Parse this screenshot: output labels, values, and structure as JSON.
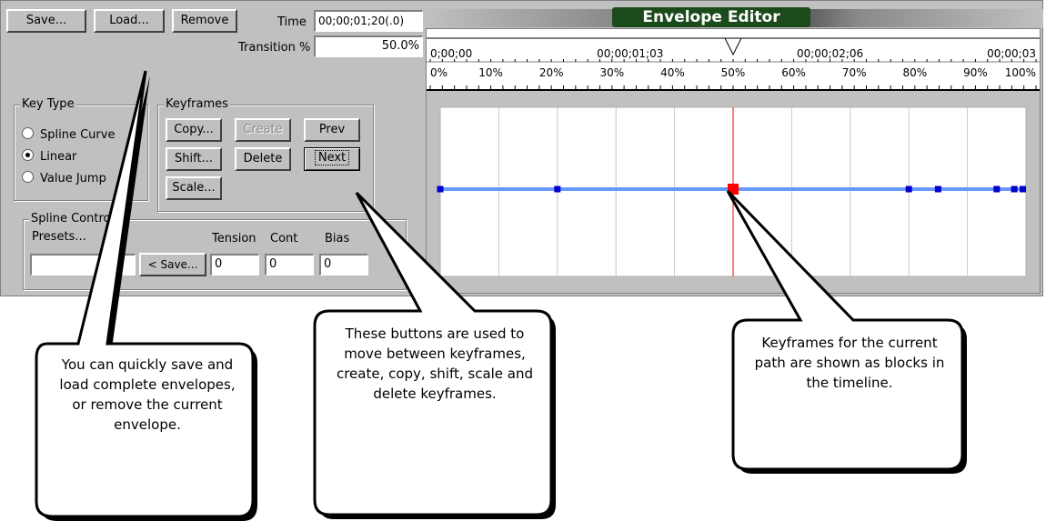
{
  "title": "Envelope Editor",
  "toolbar": {
    "save_label": "Save...",
    "load_label": "Load...",
    "remove_label": "Remove"
  },
  "time": {
    "label": "Time",
    "value": "00;00;01;20(.0)"
  },
  "transition": {
    "label": "Transition %",
    "value": "50.0%"
  },
  "key_type": {
    "legend": "Key Type",
    "options": [
      {
        "label": "Spline Curve",
        "selected": false
      },
      {
        "label": "Linear",
        "selected": true
      },
      {
        "label": "Value Jump",
        "selected": false
      }
    ]
  },
  "keyframes": {
    "legend": "Keyframes",
    "copy": "Copy...",
    "create": "Create",
    "prev": "Prev",
    "shift": "Shift...",
    "delete": "Delete",
    "next": "Next",
    "scale": "Scale..."
  },
  "spline": {
    "legend": "Spline Controls",
    "presets_label": "Presets...",
    "save_label": "< Save...",
    "tension_label": "Tension",
    "cont_label": "Cont",
    "bias_label": "Bias",
    "tension": "0",
    "cont": "0",
    "bias": "0"
  },
  "ruler": {
    "times": [
      "0;00;00",
      "00;00;01;03",
      "00;00;02;06",
      "00;00;03"
    ],
    "percents": [
      "0%",
      "10%",
      "20%",
      "30%",
      "40%",
      "50%",
      "60%",
      "70%",
      "80%",
      "90%",
      "100%"
    ],
    "current_percent": 50
  },
  "envelope": {
    "keyframes_percent": [
      0,
      20,
      50,
      80,
      85,
      95,
      98,
      100
    ],
    "selected_index": 2,
    "line_color": "#6699ff",
    "key_color": "#0000cc",
    "selected_color": "#ff0000"
  },
  "callouts": {
    "save_load": "You can quickly save and load complete envelopes, or remove the current envelope.",
    "buttons": "These buttons are used to move between keyframes, create, copy, shift, scale and delete keyframes.",
    "keyframes": "Keyframes for the current path are shown as blocks in the timeline."
  }
}
